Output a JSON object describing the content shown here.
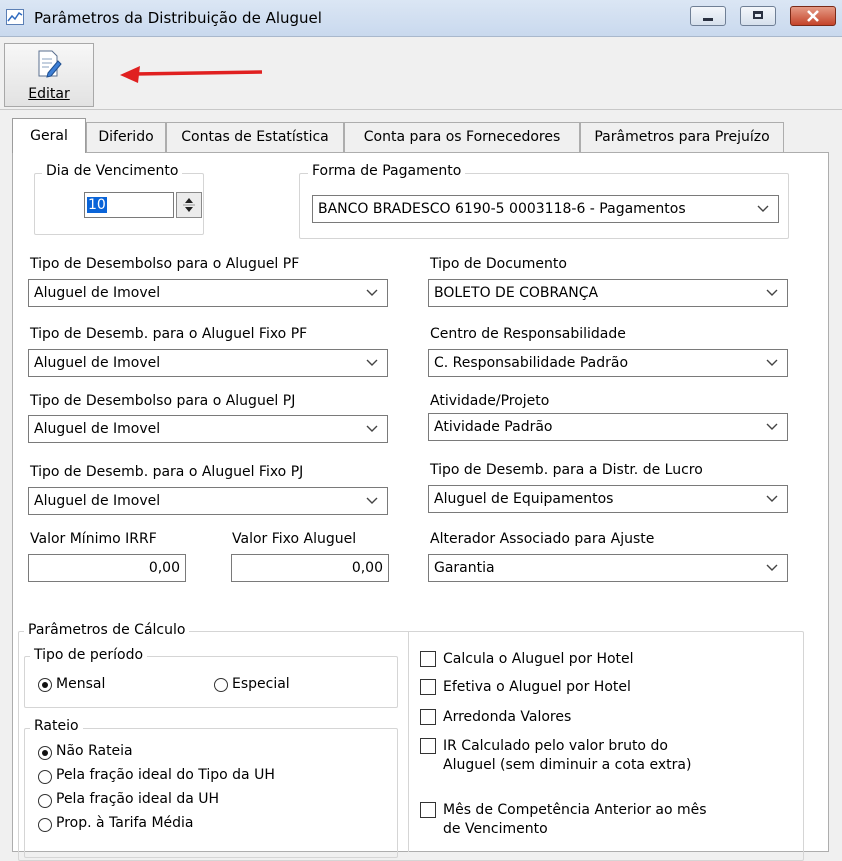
{
  "window": {
    "title": "Parâmetros da Distribuição de Aluguel",
    "icon": "chart-line-icon"
  },
  "toolbar": {
    "edit_label": "Editar",
    "edit_icon": "edit-document-icon",
    "annotation": "red-arrow-pointing-left"
  },
  "tabs": [
    {
      "label": "Geral",
      "active": true
    },
    {
      "label": "Diferido"
    },
    {
      "label": "Contas de Estatística"
    },
    {
      "label": "Conta para os Fornecedores"
    },
    {
      "label": "Parâmetros para Prejuízo"
    }
  ],
  "dia_vencimento": {
    "legend": "Dia de Vencimento",
    "value": "10"
  },
  "forma_pagamento": {
    "legend": "Forma de Pagamento",
    "value": "BANCO BRADESCO 6190-5 0003118-6 - Pagamentos"
  },
  "left_fields": [
    {
      "label": "Tipo de Desembolso para o Aluguel PF",
      "value": "Aluguel de Imovel"
    },
    {
      "label": "Tipo de Desemb. para o Aluguel Fixo PF",
      "value": "Aluguel de Imovel"
    },
    {
      "label": "Tipo de Desembolso para o Aluguel PJ",
      "value": "Aluguel de Imovel"
    },
    {
      "label": "Tipo de Desemb. para o Aluguel Fixo PJ",
      "value": "Aluguel de Imovel"
    }
  ],
  "right_fields": [
    {
      "label": "Tipo de Documento",
      "value": "BOLETO DE COBRANÇA"
    },
    {
      "label": "Centro de Responsabilidade",
      "value": "C. Responsabilidade Padrão"
    },
    {
      "label": "Atividade/Projeto",
      "value": "Atividade Padrão"
    },
    {
      "label": "Tipo de Desemb. para a Distr. de Lucro",
      "value": "Aluguel de Equipamentos"
    },
    {
      "label": "Alterador Associado para Ajuste",
      "value": "Garantia"
    }
  ],
  "valor_minimo_irrf": {
    "label": "Valor Mínimo IRRF",
    "value": "0,00"
  },
  "valor_fixo_aluguel": {
    "label": "Valor Fixo Aluguel",
    "value": "0,00"
  },
  "calculo": {
    "legend": "Parâmetros de Cálculo",
    "tipo_periodo": {
      "legend": "Tipo de período",
      "options": [
        {
          "label": "Mensal",
          "selected": true
        },
        {
          "label": "Especial",
          "selected": false
        }
      ]
    },
    "rateio": {
      "legend": "Rateio",
      "options": [
        {
          "label": "Não Rateia",
          "selected": true
        },
        {
          "label": "Pela fração ideal do Tipo da UH",
          "selected": false
        },
        {
          "label": "Pela fração ideal da UH",
          "selected": false
        },
        {
          "label": "Prop. à Tarifa Média",
          "selected": false
        }
      ]
    },
    "checks": [
      {
        "label": "Calcula o Aluguel por Hotel",
        "checked": false
      },
      {
        "label": "Efetiva o Aluguel por Hotel",
        "checked": false
      },
      {
        "label": "Arredonda Valores",
        "checked": false
      },
      {
        "label": "IR Calculado pelo valor bruto do Aluguel (sem diminuir a cota extra)",
        "checked": false
      },
      {
        "label": "Mês de Competência Anterior ao mês de Vencimento",
        "checked": false
      }
    ]
  }
}
